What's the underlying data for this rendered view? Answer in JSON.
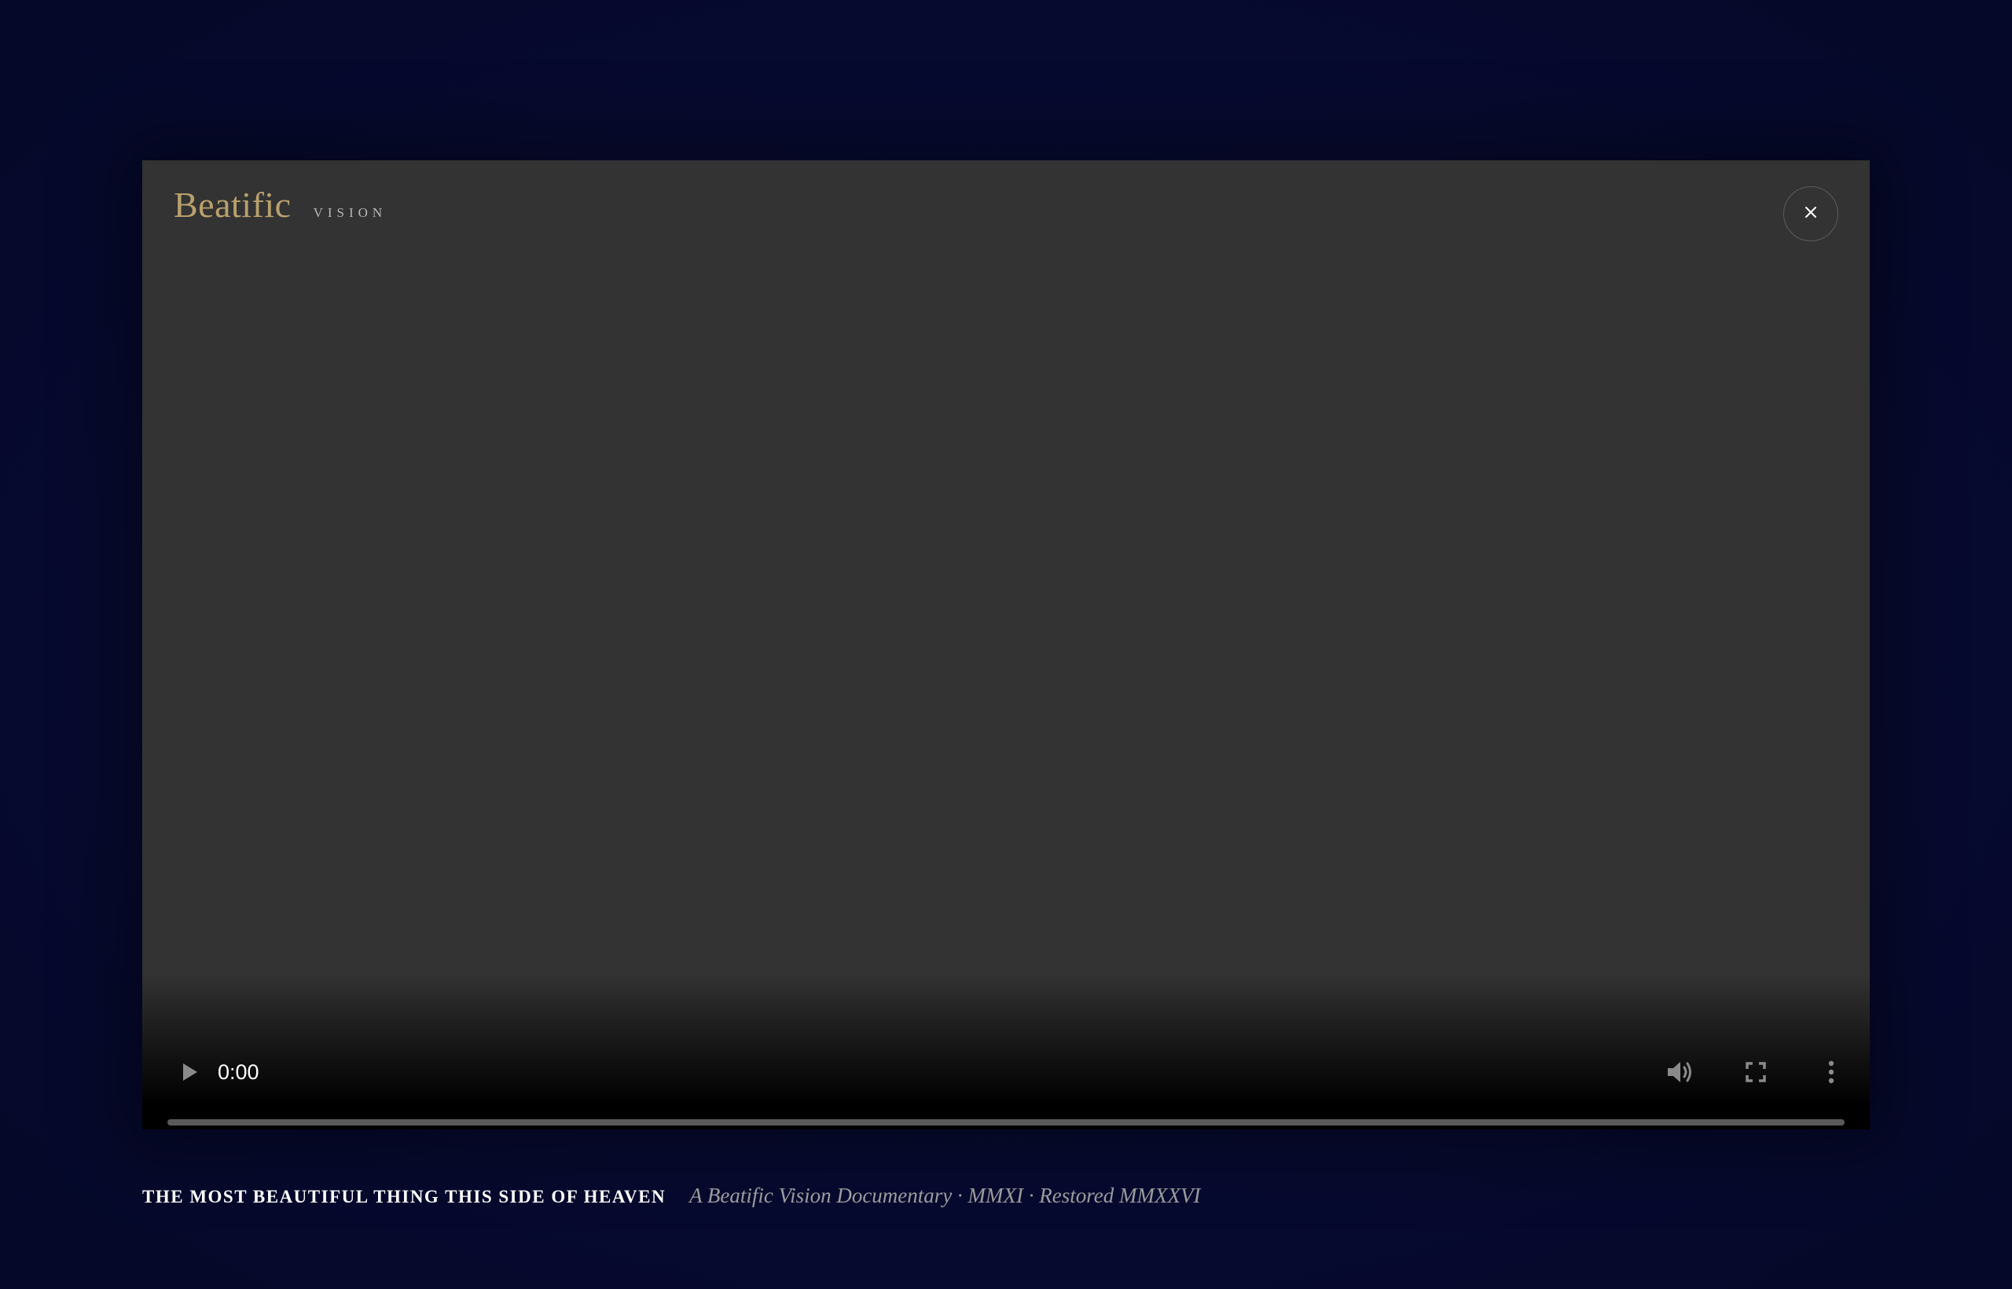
{
  "brand": {
    "title": "Beatific",
    "subtitle": "VISION"
  },
  "close_button": {
    "icon": "close-icon"
  },
  "player": {
    "current_time": "0:00",
    "progress": 0,
    "icons": {
      "play": "play-icon",
      "volume": "volume-icon",
      "fullscreen": "fullscreen-icon",
      "more": "more-options-icon"
    }
  },
  "caption": {
    "title": "THE MOST BEAUTIFUL THING THIS SIDE OF HEAVEN",
    "subtitle": "A Beatific Vision Documentary · MMXI · Restored MMXXVI"
  },
  "colors": {
    "background": "#070b33",
    "player_surface": "#333333",
    "brand_gold": "#b9a16c"
  }
}
